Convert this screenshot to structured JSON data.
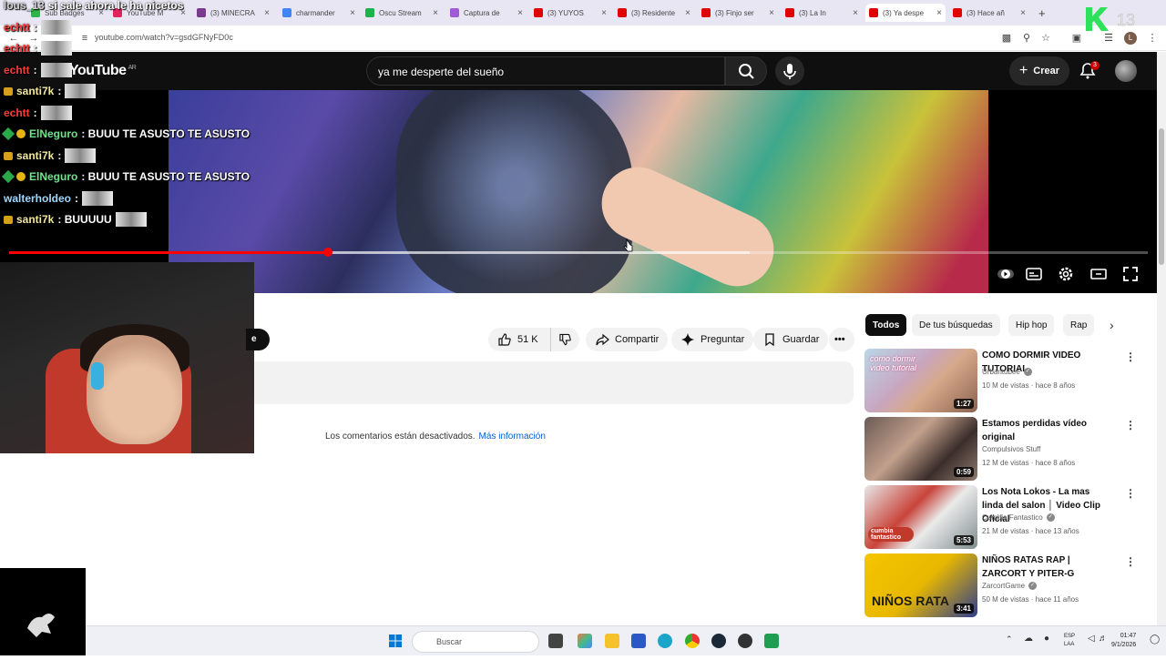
{
  "browser": {
    "tabs": [
      {
        "label": "Sub Badges",
        "color": "#2bb54a"
      },
      {
        "label": "YouTube M",
        "color": "#e0245e"
      },
      {
        "label": "(3) MINECRA",
        "color": "#7a3b8f"
      },
      {
        "label": "charmander",
        "color": "#4285f4"
      },
      {
        "label": "Oscu Stream",
        "color": "#1bb34a"
      },
      {
        "label": "Captura de",
        "color": "#a05ad6"
      },
      {
        "label": "(3) YUYOS",
        "color": "#e00000"
      },
      {
        "label": "(3) Residente",
        "color": "#e00000"
      },
      {
        "label": "(3) Finjo ser",
        "color": "#e00000"
      },
      {
        "label": "(3) La In",
        "color": "#e00000"
      },
      {
        "label": "(3) Ya despe",
        "color": "#e00000"
      },
      {
        "label": "(3) Hace añ",
        "color": "#e00000"
      }
    ],
    "active_tab_index": 10,
    "url": "youtube.com/watch?v=gsdGFNyFD0c"
  },
  "youtube": {
    "logo": "YouTube",
    "country": "AR",
    "search_query": "ya me desperte del sueño",
    "create_label": "Crear",
    "notifications_count": "3"
  },
  "player": {
    "progress_fraction": 0.28,
    "buffered_fraction": 0.65
  },
  "chat": [
    {
      "user": "lous_13",
      "text": "si sale ahora le ha nicetos",
      "color": "#cfcfcf",
      "badge": "none",
      "emote": false
    },
    {
      "user": "echtt",
      "text": ":",
      "color": "#ff3b3b",
      "badge": "none",
      "emote": true
    },
    {
      "user": "echtt",
      "text": ":",
      "color": "#ff3b3b",
      "badge": "none",
      "emote": true
    },
    {
      "user": "echtt",
      "text": ":",
      "color": "#ff3b3b",
      "badge": "none",
      "emote": true
    },
    {
      "user": "santi7k",
      "text": ":",
      "color": "#f0e6a0",
      "badge": "sub",
      "emote": true
    },
    {
      "user": "echtt",
      "text": ":",
      "color": "#ff3b3b",
      "badge": "none",
      "emote": true
    },
    {
      "user": "ElNeguro",
      "text": ": BUUU TE ASUSTO TE ASUSTO",
      "color": "#6fe28a",
      "badge": "gem",
      "emote": false
    },
    {
      "user": "santi7k",
      "text": ":",
      "color": "#f0e6a0",
      "badge": "sub",
      "emote": true
    },
    {
      "user": "ElNeguro",
      "text": ": BUUU TE ASUSTO TE ASUSTO",
      "color": "#6fe28a",
      "badge": "gem",
      "emote": false
    },
    {
      "user": "walterholdeo",
      "text": ":",
      "color": "#9fd8ff",
      "badge": "none",
      "emote": true
    },
    {
      "user": "santi7k",
      "text": ": BUUUUU",
      "color": "#f0e6a0",
      "badge": "sub",
      "emote": true
    }
  ],
  "video_actions": {
    "likes": "51 K",
    "share": "Compartir",
    "ask": "Preguntar",
    "save": "Guardar"
  },
  "comments": {
    "disabled_text": "Los comentarios están desactivados.",
    "more_info": "Más información"
  },
  "sidebar": {
    "chips": [
      "Todos",
      "De tus búsquedas",
      "Hip hop",
      "Rap"
    ],
    "recommendations": [
      {
        "title": "COMO DORMIR VIDEO TUTORIAL",
        "channel": "Urbantubee",
        "verified": true,
        "meta": "10 M de vistas · hace 8 años",
        "duration": "1:27",
        "thumb_text": "como dormir video tutorial"
      },
      {
        "title": "Estamos perdidas  vídeo original",
        "channel": "Compulsivos Stuff",
        "verified": false,
        "meta": "12 M de vistas · hace 8 años",
        "duration": "0:59",
        "thumb_text": ""
      },
      {
        "title": "Los Nota Lokos - La mas linda del salon │ Video Clip Oficial",
        "channel": "Cumbia Fantastico",
        "verified": true,
        "meta": "21 M de vistas · hace 13 años",
        "duration": "5:53",
        "thumb_text": "cumbia fantastico"
      },
      {
        "title": "NIÑOS RATAS RAP | ZARCORT Y PITER-G",
        "channel": "ZarcortGame",
        "verified": true,
        "meta": "50 M de vistas · hace 11 años",
        "duration": "3:41",
        "thumb_text": "NIÑOS RATA"
      }
    ]
  },
  "taskbar": {
    "search_placeholder": "Buscar",
    "lang_top": "ESP",
    "lang_bottom": "LAA",
    "time": "01:47",
    "date": "9/1/2026"
  }
}
